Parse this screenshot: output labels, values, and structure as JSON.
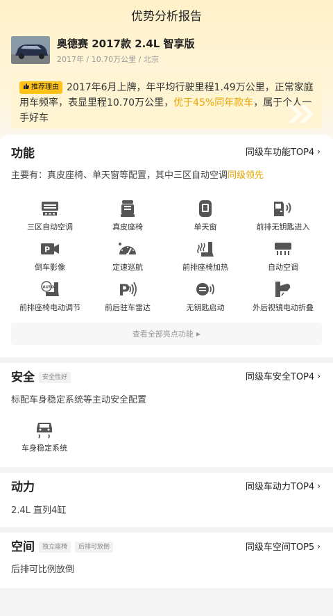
{
  "header": {
    "title": "优势分析报告"
  },
  "car": {
    "name": "奥德赛 2017款 2.4L 智享版",
    "meta": "2017年 / 10.70万公里 / 北京"
  },
  "reason": {
    "tag": "推荐理由",
    "text_before": "2017年6月上牌，年平均行驶里程1.49万公里，正常家庭用车频率，表显里程10.70万公里，",
    "highlight": "优于45%同年款车",
    "text_after": "，属于个人一手好车"
  },
  "features": {
    "title": "功能",
    "rank": "同级车功能TOP4",
    "summary_prefix": "主要有：真皮座椅、单天窗等配置，其中三区自动空调",
    "summary_highlight": "同级领先",
    "items": [
      {
        "label": "三区自动空调",
        "icon": "ac-panel-icon"
      },
      {
        "label": "真皮座椅",
        "icon": "seat-icon"
      },
      {
        "label": "单天窗",
        "icon": "sunroof-icon"
      },
      {
        "label": "前排无钥匙进入",
        "icon": "keyless-entry-icon"
      },
      {
        "label": "倒车影像",
        "icon": "reverse-camera-icon"
      },
      {
        "label": "定速巡航",
        "icon": "cruise-control-icon"
      },
      {
        "label": "前排座椅加热",
        "icon": "seat-heating-icon"
      },
      {
        "label": "自动空调",
        "icon": "auto-ac-icon"
      },
      {
        "label": "前排座椅电动调节",
        "icon": "power-seat-icon"
      },
      {
        "label": "前后驻车雷达",
        "icon": "parking-radar-icon"
      },
      {
        "label": "无钥匙启动",
        "icon": "keyless-start-icon"
      },
      {
        "label": "外后视镜电动折叠",
        "icon": "mirror-fold-icon"
      }
    ],
    "view_all": "查看全部亮点功能"
  },
  "safety": {
    "title": "安全",
    "chip": "安全性好",
    "rank": "同级车安全TOP4",
    "summary": "标配车身稳定系统等主动安全配置",
    "items": [
      {
        "label": "车身稳定系统",
        "icon": "stability-control-icon"
      }
    ]
  },
  "power": {
    "title": "动力",
    "rank": "同级车动力TOP4",
    "summary": "2.4L 直列4缸"
  },
  "space": {
    "title": "空间",
    "chips": [
      "独立座椅",
      "后排可放倒"
    ],
    "rank": "同级车空间TOP5",
    "summary": "后排可比例放倒"
  },
  "colors": {
    "accent": "#ffc21a",
    "highlight": "#e8a400",
    "icon": "#555555"
  }
}
